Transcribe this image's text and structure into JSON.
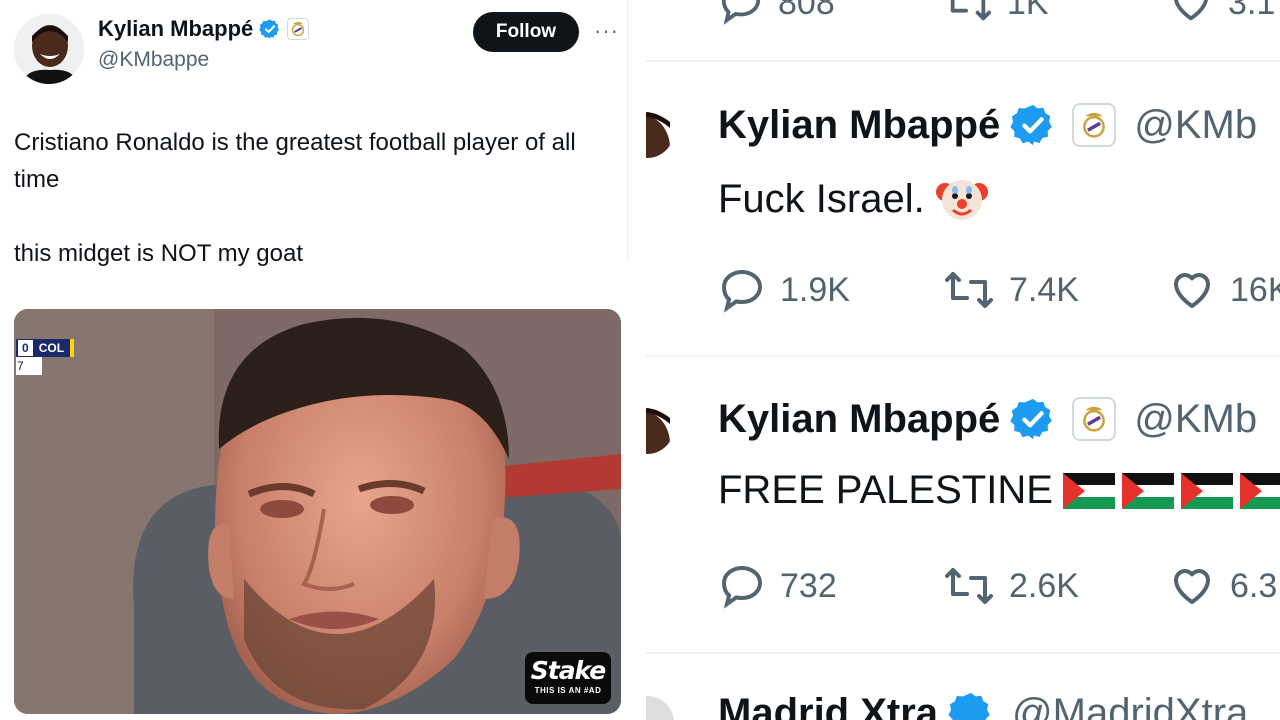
{
  "left_tweet": {
    "author_name": "Kylian Mbappé",
    "author_handle": "@KMbappe",
    "follow_label": "Follow",
    "more_label": "···",
    "text_lines": [
      "Cristiano Ronaldo is the greatest football player of all time",
      "this midget is NOT my goat"
    ],
    "media": {
      "scoreboard_score": "0",
      "scoreboard_team": "COL",
      "scoreboard_clock": "7",
      "sponsor_logo": "Stake",
      "sponsor_sub": "THIS IS AN #AD"
    }
  },
  "right_top_stats": {
    "replies": "808",
    "reposts": "1K",
    "likes": "3.1"
  },
  "right_tweets": [
    {
      "author_name": "Kylian Mbappé",
      "author_handle": "@KMb",
      "text": "Fuck Israel.",
      "emoji": "clown-face-icon",
      "replies": "1.9K",
      "reposts": "7.4K",
      "likes": "16K"
    },
    {
      "author_name": "Kylian Mbappé",
      "author_handle": "@KMb",
      "text": "FREE PALESTINE",
      "emoji": "palestine-flag-icon",
      "replies": "732",
      "reposts": "2.6K",
      "likes": "6.3"
    },
    {
      "author_name": "Madrid Xtra",
      "author_handle": "@MadridXtra"
    }
  ],
  "colors": {
    "verified_blue": "#1d9bf0",
    "text_primary": "#0f1419",
    "text_secondary": "#536471",
    "follow_bg": "#0f1419"
  }
}
